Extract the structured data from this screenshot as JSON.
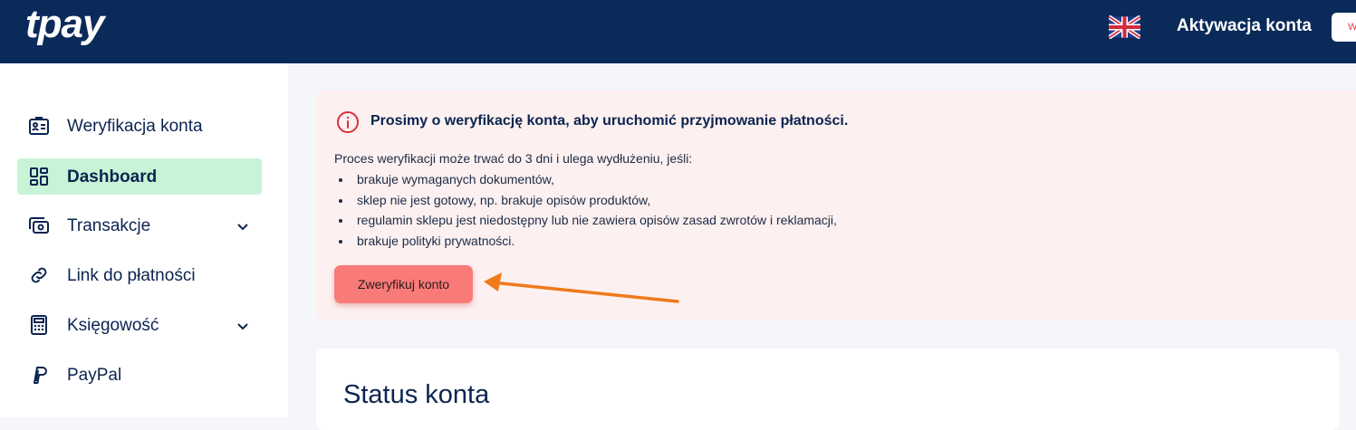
{
  "header": {
    "logo_text": "tpay",
    "language_flag": "uk-flag-icon",
    "title": "Aktywacja konta",
    "button_label": "W",
    "background": "#0a2a5a"
  },
  "sidebar": {
    "items": [
      {
        "label": "Weryfikacja konta",
        "icon": "id-card-icon",
        "active": false,
        "expandable": false
      },
      {
        "label": "Dashboard",
        "icon": "dashboard-grid-icon",
        "active": true,
        "expandable": false
      },
      {
        "label": "Transakcje",
        "icon": "cash-icon",
        "active": false,
        "expandable": true
      },
      {
        "label": "Link do płatności",
        "icon": "link-icon",
        "active": false,
        "expandable": false
      },
      {
        "label": "Księgowość",
        "icon": "calculator-icon",
        "active": false,
        "expandable": true
      },
      {
        "label": "PayPal",
        "icon": "paypal-icon",
        "active": false,
        "expandable": false
      }
    ],
    "active_color": "#c8f3d6"
  },
  "alert": {
    "title": "Prosimy o weryfikację konta, aby uruchomić przyjmowanie płatności.",
    "intro": "Proces weryfikacji może trwać do 3 dni i ulega wydłużeniu, jeśli:",
    "bullets": [
      "brakuje wymaganych dokumentów,",
      "sklep nie jest gotowy, np. brakuje opisów produktów,",
      "regulamin sklepu jest niedostępny lub nie zawiera opisów zasad zwrotów i reklamacji,",
      "brakuje polityki prywatności."
    ],
    "button_label": "Zweryfikuj konto",
    "background": "#fdf0f0",
    "button_color": "#f97b78",
    "arrow_color": "#f07a1a"
  },
  "status_card": {
    "title": "Status konta"
  }
}
